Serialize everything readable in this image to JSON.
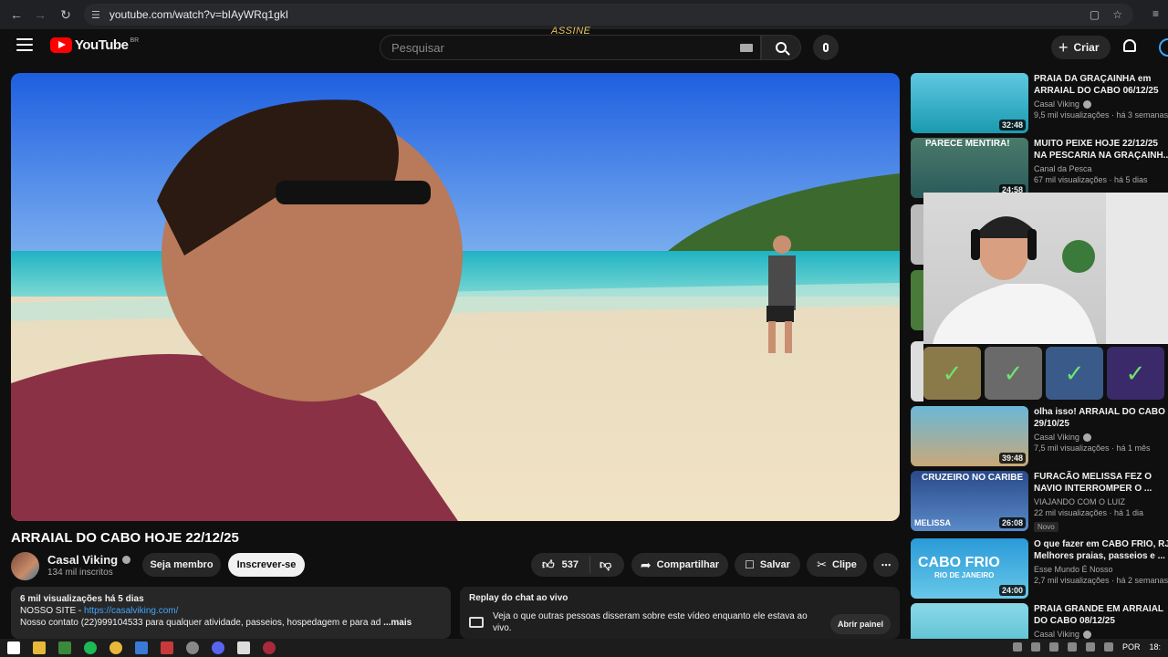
{
  "browser": {
    "url": "youtube.com/watch?v=bIAyWRq1gkI",
    "overlay_text": "ASSINE"
  },
  "header": {
    "logo_text": "YouTube",
    "region": "BR",
    "search_placeholder": "Pesquisar",
    "create_label": "Criar"
  },
  "video": {
    "title": "ARRAIAL DO CABO HOJE 22/12/25",
    "channel": "Casal Viking",
    "subscribers": "134 mil inscritos",
    "member_label": "Seja membro",
    "subscribe_label": "Inscrever-se",
    "likes": "537",
    "share_label": "Compartilhar",
    "save_label": "Salvar",
    "clip_label": "Clipe"
  },
  "description": {
    "meta": "6 mil visualizações  há 5 dias",
    "site_prefix": "NOSSO SITE - ",
    "site_link": "https://casalviking.com/",
    "contact": "Nosso contato (22)999104533 para qualquer atividade, passeios, hospedagem e para ad",
    "more": "...mais"
  },
  "chat_replay": {
    "title": "Replay do chat ao vivo",
    "body": "Veja o que outras pessoas disseram sobre este vídeo enquanto ele estava ao vivo.",
    "button": "Abrir painel"
  },
  "recommendations": [
    {
      "title_1": "PRAIA DA GRAÇAINHA em",
      "title_2": "ARRAIAL DO CABO 06/12/25",
      "channel": "Casal Viking",
      "verified": true,
      "views": "9,5 mil visualizações · há 3 semanas",
      "duration": "32:48"
    },
    {
      "title_1": "MUITO PEIXE HOJE 22/12/25",
      "title_2": "NA PESCARIA NA GRAÇAINH...",
      "channel": "Canal da Pesca",
      "verified": false,
      "views": "67 mil visualizações · há 5 dias",
      "duration": "24:58",
      "thumb_text": "PARECE MENTIRA!"
    },
    {
      "title_1": "olha isso! ARRAIAL DO CABO",
      "title_2": "29/10/25",
      "channel": "Casal Viking",
      "verified": true,
      "views": "7,5 mil visualizações · há 1 mês",
      "duration": "39:48"
    },
    {
      "title_1": "FURACÃO MELISSA FEZ O",
      "title_2": "NAVIO INTERROMPER O ...",
      "channel": "VIAJANDO COM O LUIZ",
      "verified": false,
      "views": "22 mil visualizações · há 1 dia",
      "duration": "26:08",
      "badge": "Novo",
      "thumb_text": "CRUZEIRO NO CARIBE",
      "thumb_text_2": "MELISSA"
    },
    {
      "title_1": "O que fazer em CABO FRIO, RJ",
      "title_2": "Melhores praias, passeios e ...",
      "channel": "Esse Mundo É Nosso",
      "verified": false,
      "views": "2,7 mil visualizações · há 2 semanas",
      "duration": "24:00",
      "thumb_text": "CABO FRIO",
      "thumb_text_2": "RIO DE JANEIRO"
    },
    {
      "title_1": "PRAIA GRANDE EM ARRAIAL",
      "title_2": "DO CABO 08/12/25",
      "channel": "Casal Viking",
      "verified": true,
      "views": "",
      "duration": ""
    }
  ],
  "taskbar": {
    "language": "POR",
    "time": "18:"
  },
  "colors": {
    "bg": "#0f0f0f",
    "accent_red": "#ff0000",
    "link_blue": "#3ea6ff",
    "check_green": "#6fe36f"
  }
}
